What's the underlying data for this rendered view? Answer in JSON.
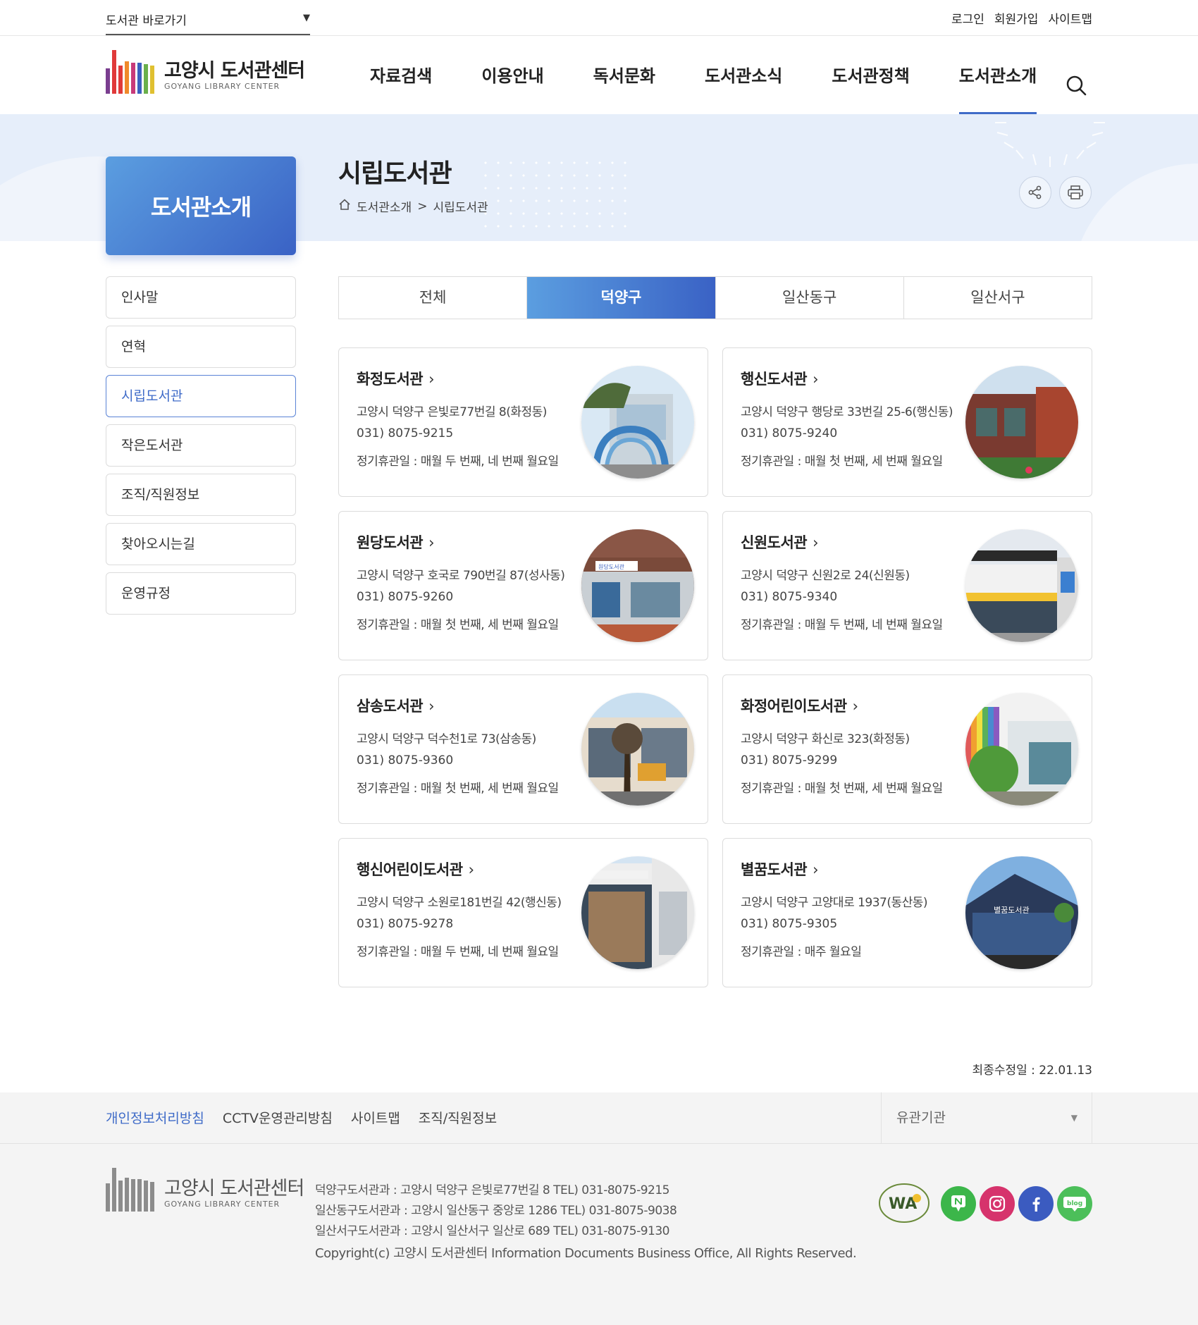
{
  "util": {
    "library_select": "도서관 바로가기",
    "links": [
      "로그인",
      "회원가입",
      "사이트맵"
    ]
  },
  "logo": {
    "title": "고양시 도서관센터",
    "subtitle": "GOYANG LIBRARY CENTER",
    "bar_colors": [
      "#e03a3a",
      "#f08a2b",
      "#7a3e8f",
      "#3b5fc0",
      "#c83a7a",
      "#e8a02a",
      "#9a6a9a",
      "#3aa0a0",
      "#6ab04c",
      "#e0c030"
    ]
  },
  "gnb": [
    "자료검색",
    "이용안내",
    "독서문화",
    "도서관소식",
    "도서관정책",
    "도서관소개"
  ],
  "page": {
    "title": "시립도서관",
    "breadcrumb": [
      "도서관소개",
      ">",
      "시립도서관"
    ]
  },
  "lnb": {
    "title": "도서관소개",
    "items": [
      "인사말",
      "연혁",
      "시립도서관",
      "작은도서관",
      "조직/직원정보",
      "찾아오시는길",
      "운영규정"
    ],
    "active": "시립도서관"
  },
  "tabs": {
    "items": [
      "전체",
      "덕양구",
      "일산동구",
      "일산서구"
    ],
    "active": "덕양구"
  },
  "libraries": [
    {
      "name": "화정도서관",
      "address": "고양시 덕양구 은빛로77번길 8(화정동)",
      "tel": "031) 8075-9215",
      "closed": "정기휴관일 : 매월 두 번째, 네 번째 월요일"
    },
    {
      "name": "행신도서관",
      "address": "고양시 덕양구 행당로 33번길 25-6(행신동)",
      "tel": "031) 8075-9240",
      "closed": "정기휴관일 : 매월 첫 번째, 세 번째 월요일"
    },
    {
      "name": "원당도서관",
      "address": "고양시 덕양구 호국로 790번길 87(성사동)",
      "tel": "031) 8075-9260",
      "closed": "정기휴관일 : 매월 첫 번째, 세 번째 월요일"
    },
    {
      "name": "신원도서관",
      "address": "고양시 덕양구 신원2로 24(신원동)",
      "tel": "031) 8075-9340",
      "closed": "정기휴관일 : 매월 두 번째, 네 번째 월요일"
    },
    {
      "name": "삼송도서관",
      "address": "고양시 덕양구 덕수천1로 73(삼송동)",
      "tel": "031) 8075-9360",
      "closed": "정기휴관일 : 매월 첫 번째, 세 번째 월요일"
    },
    {
      "name": "화정어린이도서관",
      "address": "고양시 덕양구 화신로 323(화정동)",
      "tel": "031) 8075-9299",
      "closed": "정기휴관일 : 매월 첫 번째, 세 번째 월요일"
    },
    {
      "name": "행신어린이도서관",
      "address": "고양시 덕양구 소원로181번길 42(행신동)",
      "tel": "031) 8075-9278",
      "closed": "정기휴관일 : 매월 두 번째, 네 번째 월요일"
    },
    {
      "name": "별꿈도서관",
      "address": "고양시 덕양구 고양대로 1937(동산동)",
      "tel": "031) 8075-9305",
      "closed": "정기휴관일 : 매주 월요일"
    }
  ],
  "photo_signs": {
    "wondang": "원당도서관",
    "byeolkkum": "별꿈도서관"
  },
  "updated": "최종수정일 : 22.01.13",
  "footer": {
    "links": [
      "개인정보처리방침",
      "CCTV운영관리방침",
      "사이트맵",
      "조직/직원정보"
    ],
    "related": "유관기관",
    "info": [
      "덕양구도서관과 : 고양시 덕양구 은빛로77번길 8 TEL) 031-8075-9215",
      "일산동구도서관과 : 고양시 일산동구 중앙로 1286 TEL) 031-8075-9038",
      "일산서구도서관과 : 고양시 일산서구 일산로 689 TEL) 031-8075-9130"
    ],
    "copyright": "Copyright(c) 고양시 도서관센터 Information Documents Business Office, All Rights Reserved.",
    "wa_mark": "WA",
    "sns": [
      {
        "icon": "naver-post-icon",
        "label": "N",
        "color": "#3cb64a"
      },
      {
        "icon": "instagram-icon",
        "label": "",
        "color": "#d6336c"
      },
      {
        "icon": "facebook-icon",
        "label": "f",
        "color": "#3b5bc0"
      },
      {
        "icon": "blog-icon",
        "label": "blog",
        "color": "#4cbf5a"
      }
    ]
  }
}
